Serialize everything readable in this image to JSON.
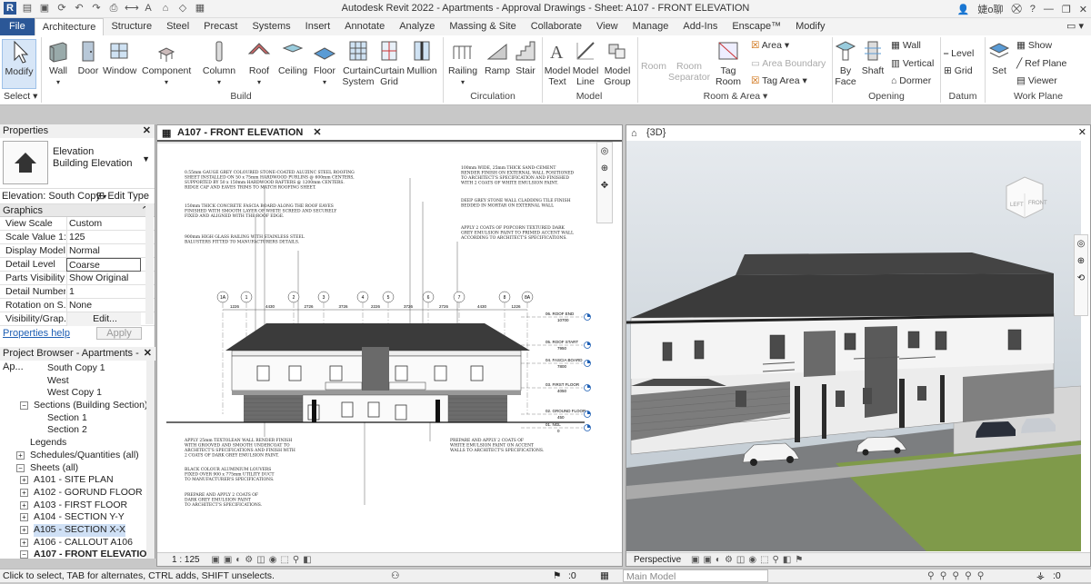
{
  "app_title": "Autodesk Revit 2022 - Apartments - Approval Drawings - Sheet: A107 - FRONT ELEVATION",
  "user_name": "婕o聊",
  "tabs": [
    "File",
    "Architecture",
    "Structure",
    "Steel",
    "Precast",
    "Systems",
    "Insert",
    "Annotate",
    "Analyze",
    "Massing & Site",
    "Collaborate",
    "View",
    "Manage",
    "Add-Ins",
    "Enscape™",
    "Modify"
  ],
  "ribbon": {
    "modify": "Modify",
    "select": "Select ▾",
    "wall": "Wall",
    "door": "Door",
    "window": "Window",
    "component": "Component",
    "column": "Column",
    "roof": "Roof",
    "ceiling": "Ceiling",
    "floor": "Floor",
    "curtain_system": "Curtain System",
    "curtain_grid": "Curtain Grid",
    "mullion": "Mullion",
    "railing": "Railing",
    "ramp": "Ramp",
    "stair": "Stair",
    "model_text": "Model Text",
    "model_line": "Model Line",
    "model_group": "Model Group",
    "room": "Room",
    "room_separator": "Room Separator",
    "tag_room": "Tag Room",
    "area": "Area",
    "area_boundary": "Area  Boundary",
    "tag_area": "Tag  Area",
    "by_face": "By Face",
    "shaft": "Shaft",
    "wall_op": "Wall",
    "vertical": "Vertical",
    "dormer": "Dormer",
    "level": "Level",
    "grid": "Grid",
    "set": "Set",
    "show": "Show",
    "ref_plane": "Ref  Plane",
    "viewer": "Viewer",
    "panels": {
      "build": "Build",
      "circulation": "Circulation",
      "model": "Model",
      "room_area": "Room & Area ▾",
      "opening": "Opening",
      "datum": "Datum",
      "work_plane": "Work Plane"
    }
  },
  "properties": {
    "title": "Properties",
    "type1": "Elevation",
    "type2": "Building Elevation",
    "selector": "Elevation: South Copy",
    "edit_type": "Edit Type",
    "group": "Graphics",
    "rows": [
      {
        "k": "View Scale",
        "v": "Custom"
      },
      {
        "k": "Scale Value  1:",
        "v": "125"
      },
      {
        "k": "Display Model",
        "v": "Normal"
      },
      {
        "k": "Detail Level",
        "v": "Coarse"
      },
      {
        "k": "Parts Visibility",
        "v": "Show Original"
      },
      {
        "k": "Detail Number",
        "v": "1"
      },
      {
        "k": "Rotation on S...",
        "v": "None"
      },
      {
        "k": "Visibility/Grap...",
        "v": "Edit..."
      }
    ],
    "help": "Properties help",
    "apply": "Apply"
  },
  "browser": {
    "title": "Project Browser - Apartments - Ap...",
    "items": [
      {
        "label": "South Copy 1",
        "indent": 52,
        "box": ""
      },
      {
        "label": "West",
        "indent": 52,
        "box": ""
      },
      {
        "label": "West Copy 1",
        "indent": 52,
        "box": ""
      },
      {
        "label": "Sections (Building Section)",
        "indent": 37,
        "box": "−"
      },
      {
        "label": "Section 1",
        "indent": 52,
        "box": ""
      },
      {
        "label": "Section 2",
        "indent": 52,
        "box": ""
      },
      {
        "label": "Legends",
        "indent": 33,
        "box": ""
      },
      {
        "label": "Schedules/Quantities (all)",
        "indent": 33,
        "box": "+"
      },
      {
        "label": "Sheets (all)",
        "indent": 33,
        "box": "−"
      },
      {
        "label": "A101 - SITE PLAN",
        "indent": 37,
        "box": "+"
      },
      {
        "label": "A102 - GORUND FLOOR",
        "indent": 37,
        "box": "+"
      },
      {
        "label": "A103 - FIRST FLOOR",
        "indent": 37,
        "box": "+"
      },
      {
        "label": "A104 - SECTION Y-Y",
        "indent": 37,
        "box": "+"
      },
      {
        "label": "A105 - SECTION X-X",
        "indent": 37,
        "box": "+"
      },
      {
        "label": "A106 - CALLOUT A106",
        "indent": 37,
        "box": "+"
      },
      {
        "label": "A107 - FRONT ELEVATION",
        "indent": 37,
        "box": "−"
      }
    ]
  },
  "view_a": {
    "tab": "A107 - FRONT ELEVATION",
    "scale": "1 : 125",
    "notes_left": [
      "0.55mm GAUGE GREY COLOURED STONE-COATED ALUZINC STEEL ROOFING",
      "SHEET INSTALLED ON 50 x 75mm HARDWOOD PURLINS @ 600mm CENTERS,",
      "SUPPORTED BY 50 x 150mm HARDWOOD RAFTERS @ 1200mm CENTERS.",
      "RIDGE CAP AND EAVES TRIMS TO MATCH ROOFING SHEET.",
      "150mm THICK CONCRETE FASCIA BOARD ALONG THE ROOF EAVES",
      "FINISHED WITH SMOOTH LAYER OF WHITE SCREED AND SECURELY",
      "FIXED AND ALIGNED WITH THE ROOF EDGE.",
      "900mm HIGH GLASS RAILING WITH STAINLESS STEEL",
      "BALUSTERS FITTED TO MANUFACTURERS DETAILS."
    ],
    "notes_right": [
      "100mm WIDE, 25mm THICK SAND-CEMENT",
      "RENDER FINISH ON EXTERNAL WALL POSITIONED",
      "TO ARCHITECT'S SPECIFICATION AND FINISHED",
      "WITH 2 COATS OF WHITE EMULSION PAINT.",
      "DEEP GREY STONE WALL CLADDING TILE FINISH",
      "BEDDED IN MORTAR ON EXTERNAL WALL",
      "APPLY 2 COATS OF POPCORN TEXTURED DARK",
      "GREY EMULSION PAINT TO PRIMED ACCENT WALL",
      "ACCORDING TO ARCHITECT'S SPECIFICATIONS."
    ],
    "notes_bottom_left": [
      "APPLY 25mm TEXTOLEAN WALL RENDER FINISH",
      "WITH GROOVED AND SMOOTH UNDERCOAT TO",
      "ARCHITECT'S SPECIFICATIONS AND FINISH WITH",
      "2 COATS OF DARK GREY EMULSION PAINT.",
      "BLACK COLOUR ALUMINIUM LOUVERS",
      "FIXED OVER 900 x 775mm UTILITY DUCT",
      "TO MANUFACTURER'S SPECIFICATIONS.",
      "PREPARE AND APPLY 2 COATS OF",
      "DARK GREY EMULSION PAINT",
      "TO ARCHITECT'S SPECIFICATIONS."
    ],
    "notes_bottom_right": [
      "PREPARE AND APPLY 2 COATS OF",
      "WHITE EMULSION PAINT ON ACCENT",
      "WALLS TO ARCHITECT'S SPECIFICATIONS."
    ],
    "grids": [
      "1A",
      "1",
      "2",
      "3",
      "4",
      "5",
      "6",
      "7",
      "8",
      "8A"
    ],
    "dims": [
      "1226",
      "4430",
      "2726",
      "3726",
      "2226",
      "3726",
      "2726",
      "4430",
      "1226"
    ],
    "levels": [
      {
        "name": "06. ROOF END",
        "elev": "10700"
      },
      {
        "name": "05. ROOF START",
        "elev": "7950"
      },
      {
        "name": "04. FASCIA BOARD",
        "elev": "7800"
      },
      {
        "name": "03. FIRST FLOOR",
        "elev": "4050"
      },
      {
        "name": "02. GROUND FLOOR",
        "elev": "450"
      },
      {
        "name": "01. NGL",
        "elev": "0"
      }
    ]
  },
  "view_b": {
    "tab": "{3D}",
    "mode": "Perspective",
    "cube_left": "LEFT",
    "cube_front": "FRONT"
  },
  "status": {
    "hint": "Click to select, TAB for alternates, CTRL adds, SHIFT unselects.",
    "zero1": ":0",
    "model": "Main Model",
    "zero2": ":0"
  },
  "colors": {
    "file_tab": "#2b5797",
    "roof": "#3b3b3b",
    "accent_wall": "#5a5a5a",
    "sky": "#c8d2dc",
    "grass": "#7f9a4a",
    "road": "#5a5a5e"
  }
}
